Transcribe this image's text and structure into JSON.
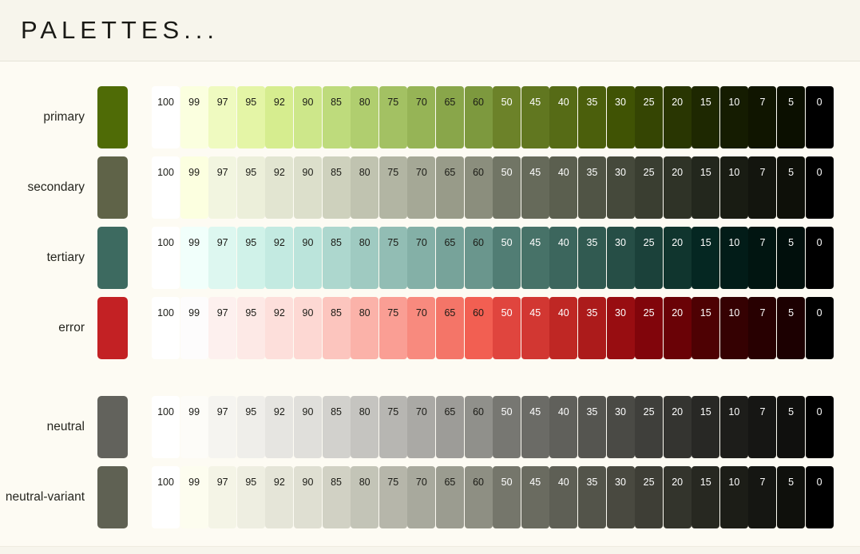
{
  "header": {
    "title": "PALETTES..."
  },
  "tones": [
    100,
    99,
    97,
    95,
    92,
    90,
    85,
    80,
    75,
    70,
    65,
    60,
    50,
    45,
    40,
    35,
    30,
    25,
    20,
    15,
    10,
    7,
    5,
    0
  ],
  "dark_text_from_tone_index": 12,
  "background": {
    "page": "#f7f5ec",
    "card": "#fdfbf3"
  },
  "palettes": [
    {
      "name": "primary",
      "key_color": "#4f6b06",
      "swatches": [
        {
          "tone": 100,
          "hex": "#ffffff"
        },
        {
          "tone": 99,
          "hex": "#fbffdf"
        },
        {
          "tone": 97,
          "hex": "#effac0"
        },
        {
          "tone": 95,
          "hex": "#e4f5a6"
        },
        {
          "tone": 92,
          "hex": "#d6ed8f"
        },
        {
          "tone": 90,
          "hex": "#cde78a"
        },
        {
          "tone": 85,
          "hex": "#bedb7c"
        },
        {
          "tone": 80,
          "hex": "#b0ce6f"
        },
        {
          "tone": 75,
          "hex": "#a3c163"
        },
        {
          "tone": 70,
          "hex": "#96b456"
        },
        {
          "tone": 65,
          "hex": "#89a64a"
        },
        {
          "tone": 60,
          "hex": "#7d993e"
        },
        {
          "tone": 50,
          "hex": "#6c8229"
        },
        {
          "tone": 45,
          "hex": "#617720"
        },
        {
          "tone": 40,
          "hex": "#566b16"
        },
        {
          "tone": 35,
          "hex": "#4b5f0c"
        },
        {
          "tone": 30,
          "hex": "#405304"
        },
        {
          "tone": 25,
          "hex": "#354503"
        },
        {
          "tone": 20,
          "hex": "#293602"
        },
        {
          "tone": 15,
          "hex": "#1e2801"
        },
        {
          "tone": 10,
          "hex": "#151c01"
        },
        {
          "tone": 7,
          "hex": "#101500"
        },
        {
          "tone": 5,
          "hex": "#0b0f00"
        },
        {
          "tone": 0,
          "hex": "#000000"
        }
      ]
    },
    {
      "name": "secondary",
      "key_color": "#5f6348",
      "swatches": [
        {
          "tone": 100,
          "hex": "#ffffff"
        },
        {
          "tone": 99,
          "hex": "#fcffe0"
        },
        {
          "tone": 97,
          "hex": "#f2f5e0"
        },
        {
          "tone": 95,
          "hex": "#ecefda"
        },
        {
          "tone": 92,
          "hex": "#e2e5d1"
        },
        {
          "tone": 90,
          "hex": "#dcdfcb"
        },
        {
          "tone": 85,
          "hex": "#ced1bd"
        },
        {
          "tone": 80,
          "hex": "#c0c3b0"
        },
        {
          "tone": 75,
          "hex": "#b2b5a3"
        },
        {
          "tone": 70,
          "hex": "#a5a896"
        },
        {
          "tone": 65,
          "hex": "#989b89"
        },
        {
          "tone": 60,
          "hex": "#8b8e7d"
        },
        {
          "tone": 50,
          "hex": "#717565"
        },
        {
          "tone": 45,
          "hex": "#666a5a"
        },
        {
          "tone": 40,
          "hex": "#5b5f4f"
        },
        {
          "tone": 35,
          "hex": "#505445"
        },
        {
          "tone": 30,
          "hex": "#45493b"
        },
        {
          "tone": 25,
          "hex": "#3a3e31"
        },
        {
          "tone": 20,
          "hex": "#2f3327"
        },
        {
          "tone": 15,
          "hex": "#23271d"
        },
        {
          "tone": 10,
          "hex": "#191c13"
        },
        {
          "tone": 7,
          "hex": "#13150e"
        },
        {
          "tone": 5,
          "hex": "#0e1009"
        },
        {
          "tone": 0,
          "hex": "#000000"
        }
      ]
    },
    {
      "name": "tertiary",
      "key_color": "#3d6a60",
      "swatches": [
        {
          "tone": 100,
          "hex": "#ffffff"
        },
        {
          "tone": 99,
          "hex": "#f1fffb"
        },
        {
          "tone": 97,
          "hex": "#ddf7f0"
        },
        {
          "tone": 95,
          "hex": "#d0f2e9"
        },
        {
          "tone": 92,
          "hex": "#c3eae1"
        },
        {
          "tone": 90,
          "hex": "#bbe4db"
        },
        {
          "tone": 85,
          "hex": "#add7ce"
        },
        {
          "tone": 80,
          "hex": "#9fcac1"
        },
        {
          "tone": 75,
          "hex": "#92bdb4"
        },
        {
          "tone": 70,
          "hex": "#84b0a7"
        },
        {
          "tone": 65,
          "hex": "#77a39a"
        },
        {
          "tone": 60,
          "hex": "#6a968d"
        },
        {
          "tone": 50,
          "hex": "#517d74"
        },
        {
          "tone": 45,
          "hex": "#477268"
        },
        {
          "tone": 40,
          "hex": "#3c665d"
        },
        {
          "tone": 35,
          "hex": "#315a51"
        },
        {
          "tone": 30,
          "hex": "#264e46"
        },
        {
          "tone": 25,
          "hex": "#1b413a"
        },
        {
          "tone": 20,
          "hex": "#10352e"
        },
        {
          "tone": 15,
          "hex": "#052722"
        },
        {
          "tone": 10,
          "hex": "#021c18"
        },
        {
          "tone": 7,
          "hex": "#011511"
        },
        {
          "tone": 5,
          "hex": "#010f0c"
        },
        {
          "tone": 0,
          "hex": "#000000"
        }
      ]
    },
    {
      "name": "error",
      "key_color": "#c32124",
      "swatches": [
        {
          "tone": 100,
          "hex": "#ffffff"
        },
        {
          "tone": 99,
          "hex": "#fdfcfc"
        },
        {
          "tone": 97,
          "hex": "#fdf0ee"
        },
        {
          "tone": 95,
          "hex": "#fde9e6"
        },
        {
          "tone": 92,
          "hex": "#fddfdb"
        },
        {
          "tone": 90,
          "hex": "#fdd8d3"
        },
        {
          "tone": 85,
          "hex": "#fcc5be"
        },
        {
          "tone": 80,
          "hex": "#fbb2a9"
        },
        {
          "tone": 75,
          "hex": "#fa9e94"
        },
        {
          "tone": 70,
          "hex": "#f88a7e"
        },
        {
          "tone": 65,
          "hex": "#f47568"
        },
        {
          "tone": 60,
          "hex": "#f25f52"
        },
        {
          "tone": 50,
          "hex": "#e0453e"
        },
        {
          "tone": 45,
          "hex": "#d23732"
        },
        {
          "tone": 40,
          "hex": "#bf2724"
        },
        {
          "tone": 35,
          "hex": "#ac1b1b"
        },
        {
          "tone": 30,
          "hex": "#980d11"
        },
        {
          "tone": 25,
          "hex": "#81050b"
        },
        {
          "tone": 20,
          "hex": "#6a0206"
        },
        {
          "tone": 15,
          "hex": "#4e0103"
        },
        {
          "tone": 10,
          "hex": "#350102"
        },
        {
          "tone": 7,
          "hex": "#280001"
        },
        {
          "tone": 5,
          "hex": "#1c0001"
        },
        {
          "tone": 0,
          "hex": "#000000"
        }
      ]
    },
    {
      "name": "neutral",
      "key_color": "#62625c",
      "group_break": true,
      "swatches": [
        {
          "tone": 100,
          "hex": "#ffffff"
        },
        {
          "tone": 99,
          "hex": "#fdfcf8"
        },
        {
          "tone": 97,
          "hex": "#f5f4f0"
        },
        {
          "tone": 95,
          "hex": "#efeeea"
        },
        {
          "tone": 92,
          "hex": "#e6e5e1"
        },
        {
          "tone": 90,
          "hex": "#e0dfdb"
        },
        {
          "tone": 85,
          "hex": "#d2d1cd"
        },
        {
          "tone": 80,
          "hex": "#c5c4c0"
        },
        {
          "tone": 75,
          "hex": "#b7b6b2"
        },
        {
          "tone": 70,
          "hex": "#aaa9a5"
        },
        {
          "tone": 65,
          "hex": "#9d9c98"
        },
        {
          "tone": 60,
          "hex": "#90908b"
        },
        {
          "tone": 50,
          "hex": "#777772"
        },
        {
          "tone": 45,
          "hex": "#6b6b66"
        },
        {
          "tone": 40,
          "hex": "#60605b"
        },
        {
          "tone": 35,
          "hex": "#555550"
        },
        {
          "tone": 30,
          "hex": "#4a4a45"
        },
        {
          "tone": 25,
          "hex": "#3f3f3b"
        },
        {
          "tone": 20,
          "hex": "#343430"
        },
        {
          "tone": 15,
          "hex": "#282825"
        },
        {
          "tone": 10,
          "hex": "#1d1d1a"
        },
        {
          "tone": 7,
          "hex": "#161614"
        },
        {
          "tone": 5,
          "hex": "#10100e"
        },
        {
          "tone": 0,
          "hex": "#000000"
        }
      ]
    },
    {
      "name": "neutral-variant",
      "key_color": "#5f6153",
      "swatches": [
        {
          "tone": 100,
          "hex": "#ffffff"
        },
        {
          "tone": 99,
          "hex": "#fdfdef"
        },
        {
          "tone": 97,
          "hex": "#f4f4e6"
        },
        {
          "tone": 95,
          "hex": "#eeeee1"
        },
        {
          "tone": 92,
          "hex": "#e5e5d8"
        },
        {
          "tone": 90,
          "hex": "#dfdfd2"
        },
        {
          "tone": 85,
          "hex": "#d1d1c4"
        },
        {
          "tone": 80,
          "hex": "#c3c4b7"
        },
        {
          "tone": 75,
          "hex": "#b6b6aa"
        },
        {
          "tone": 70,
          "hex": "#a8a99d"
        },
        {
          "tone": 65,
          "hex": "#9b9c90"
        },
        {
          "tone": 60,
          "hex": "#8e8f83"
        },
        {
          "tone": 50,
          "hex": "#75766b"
        },
        {
          "tone": 45,
          "hex": "#6a6b60"
        },
        {
          "tone": 40,
          "hex": "#5e5f55"
        },
        {
          "tone": 35,
          "hex": "#53544a"
        },
        {
          "tone": 30,
          "hex": "#494940"
        },
        {
          "tone": 25,
          "hex": "#3e3e36"
        },
        {
          "tone": 20,
          "hex": "#33342c"
        },
        {
          "tone": 15,
          "hex": "#272821"
        },
        {
          "tone": 10,
          "hex": "#1c1d17"
        },
        {
          "tone": 7,
          "hex": "#151612"
        },
        {
          "tone": 5,
          "hex": "#0f100c"
        },
        {
          "tone": 0,
          "hex": "#000000"
        }
      ]
    }
  ]
}
